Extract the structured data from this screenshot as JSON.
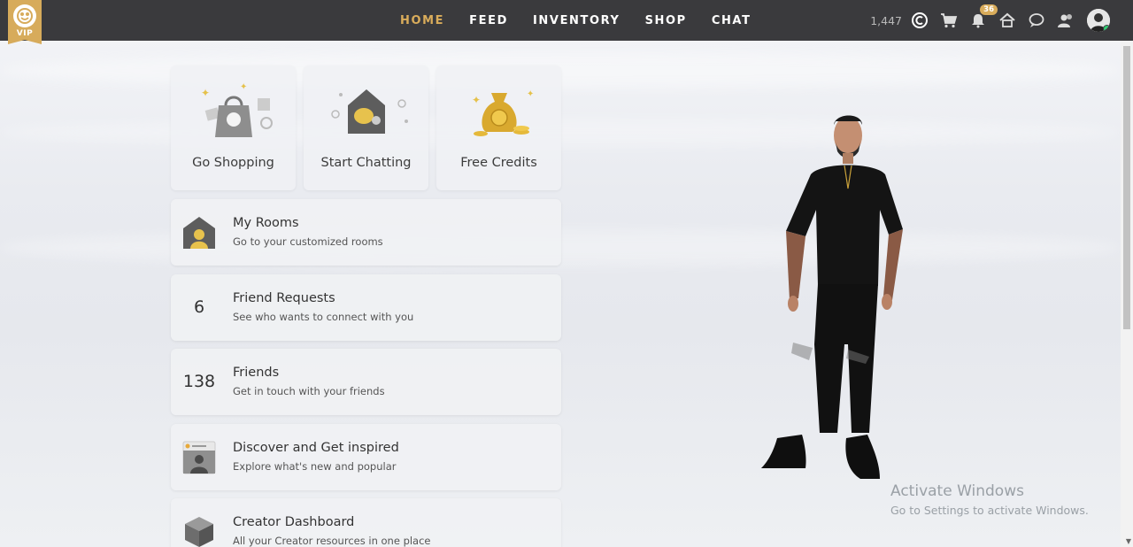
{
  "header": {
    "vip_label": "VIP",
    "nav": [
      {
        "label": "HOME",
        "active": true
      },
      {
        "label": "FEED",
        "active": false
      },
      {
        "label": "INVENTORY",
        "active": false
      },
      {
        "label": "SHOP",
        "active": false
      },
      {
        "label": "CHAT",
        "active": false
      }
    ],
    "credits": "1,447",
    "credits_icon": "credit-coin-icon",
    "notification_count": "36",
    "icons": [
      "cart-icon",
      "bell-icon",
      "home-icon",
      "chat-bubble-icon",
      "friends-icon",
      "avatar"
    ]
  },
  "tiles": [
    {
      "label": "Go Shopping",
      "icon": "shopping-bag-icon"
    },
    {
      "label": "Start Chatting",
      "icon": "chat-room-icon"
    },
    {
      "label": "Free Credits",
      "icon": "money-bag-icon"
    }
  ],
  "cards": [
    {
      "title": "My Rooms",
      "subtitle": "Go to your customized rooms",
      "icon": "room-icon"
    },
    {
      "title": "Friend Requests",
      "subtitle": "See who wants to connect with you",
      "number": "6"
    },
    {
      "title": "Friends",
      "subtitle": "Get in touch with your friends",
      "number": "138"
    },
    {
      "title": "Discover and Get inspired",
      "subtitle": "Explore what's new and popular",
      "icon": "discover-icon"
    },
    {
      "title": "Creator Dashboard",
      "subtitle": "All your Creator resources in one place",
      "icon": "cube-icon"
    }
  ],
  "watermark": {
    "title": "Activate Windows",
    "subtitle": "Go to Settings to activate Windows."
  },
  "colors": {
    "topbar": "#3a3a3d",
    "accent": "#d9ac5b",
    "online": "#2ecc71"
  }
}
